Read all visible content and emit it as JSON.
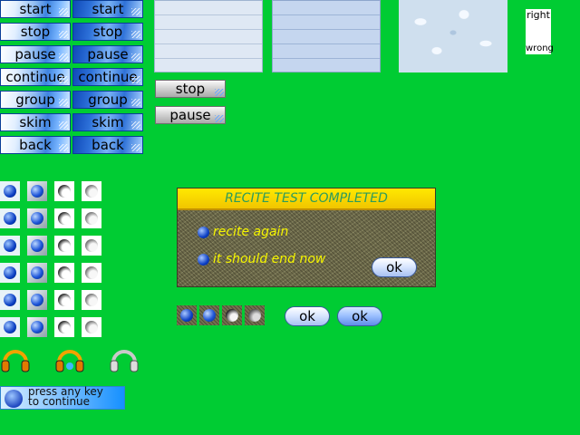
{
  "buttons": {
    "labels": [
      "start",
      "stop",
      "pause",
      "continue",
      "group",
      "skim",
      "back"
    ]
  },
  "silver_buttons": [
    "stop",
    "pause"
  ],
  "right_wrong": {
    "right": "right",
    "wrong": "wrong"
  },
  "dialog": {
    "title": "RECITE TEST COMPLETED",
    "options": [
      "recite again",
      "it should end now"
    ],
    "ok": "ok"
  },
  "ok_buttons": [
    "ok",
    "ok"
  ],
  "press_key": {
    "line1": "press any key",
    "line2": "to continue"
  },
  "icons": [
    "radio-blue-icon",
    "radio-white-icon",
    "headphone-icon",
    "microphone-icon"
  ],
  "colors": {
    "background": "#00cc33",
    "dialog_title": "#ffe900",
    "dialog_text": "#f5f500"
  }
}
